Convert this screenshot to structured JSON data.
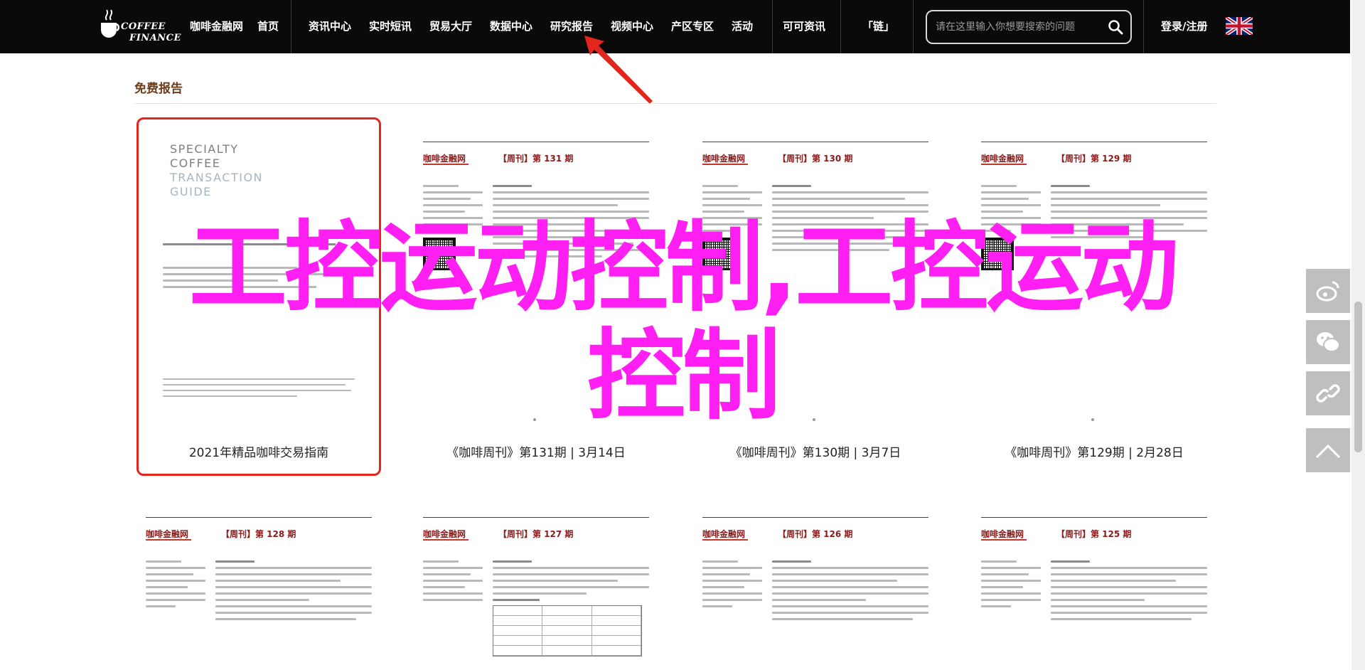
{
  "nav": {
    "logo_line1": "COFFEE",
    "logo_line2": "FINANCE",
    "brand": "咖啡金融网",
    "items": [
      "首页",
      "资讯中心",
      "实时短讯",
      "贸易大厅",
      "数据中心",
      "研究报告",
      "视频中心",
      "产区专区",
      "活动",
      "可可资讯",
      "「链」"
    ],
    "search_placeholder": "请在这里输入你想要搜索的问题",
    "login": "登录/注册"
  },
  "section": {
    "title": "免费报告"
  },
  "cards_row1": [
    {
      "type": "cover",
      "caption": "2021年精品咖啡交易指南",
      "cover_lines": [
        "SPECIALTY",
        "COFFEE",
        "TRANSACTION",
        "GUIDE"
      ],
      "selected": true
    },
    {
      "type": "issue",
      "brand": "咖啡金融网",
      "issue": "【周刊】第 131 期",
      "caption": "《咖啡周刊》第131期 | 3月14日"
    },
    {
      "type": "issue",
      "brand": "咖啡金融网",
      "issue": "【周刊】第 130 期",
      "caption": "《咖啡周刊》第130期 | 3月7日"
    },
    {
      "type": "issue",
      "brand": "咖啡金融网",
      "issue": "【周刊】第 129 期",
      "caption": "《咖啡周刊》第129期 | 2月28日"
    }
  ],
  "cards_row2": [
    {
      "brand": "咖啡金融网",
      "issue": "【周刊】第 128 期"
    },
    {
      "brand": "咖啡金融网",
      "issue": "【周刊】第 127 期"
    },
    {
      "brand": "咖啡金融网",
      "issue": "【周刊】第 126 期"
    },
    {
      "brand": "咖啡金融网",
      "issue": "【周刊】第 125 期"
    }
  ],
  "overlay": {
    "line1": "工控运动控制,工控运动",
    "line2": "控制"
  },
  "side_buttons": [
    "weibo-icon",
    "wechat-icon",
    "link-icon",
    "back-to-top-icon"
  ],
  "colors": {
    "nav_bg": "#0a0a0a",
    "section_title": "#6b3d1c",
    "highlight": "#e3261c",
    "overlay_text": "#ff1ff2",
    "doc_brand": "#8b1a1a"
  }
}
